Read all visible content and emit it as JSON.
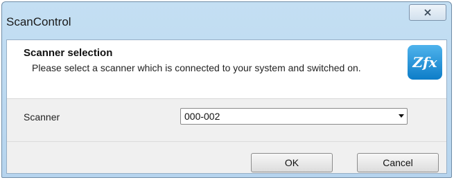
{
  "window": {
    "title": "ScanControl",
    "close_icon": "close-icon"
  },
  "header": {
    "title": "Scanner selection",
    "description": "Please select a scanner which is connected to your system and switched on.",
    "logo_text": "Zfx"
  },
  "form": {
    "scanner_label": "Scanner",
    "scanner_value": "000-002"
  },
  "buttons": {
    "ok_label": "OK",
    "cancel_label": "Cancel"
  },
  "colors": {
    "titlebar": "#c4dff3",
    "logo": "#1a8ad4"
  }
}
